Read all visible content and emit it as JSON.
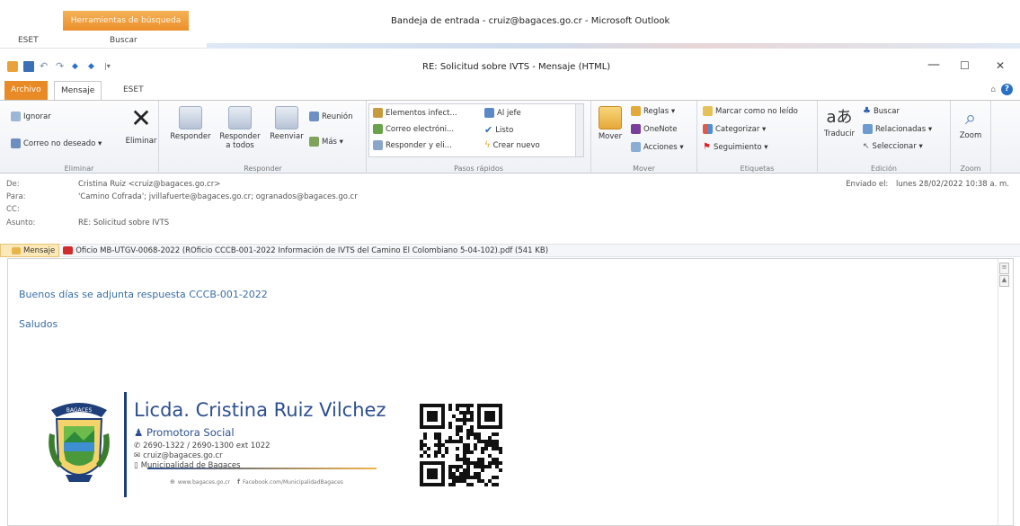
{
  "outer": {
    "context_tab": "Herramientas de búsqueda",
    "tabs": [
      "ESET",
      "Buscar"
    ],
    "title": "Bandeja de entrada - cruiz@bagaces.go.cr - Microsoft Outlook"
  },
  "window": {
    "title": "RE: Solicitud sobre IVTS - Mensaje (HTML)",
    "controls": {
      "minimize": "—",
      "maximize": "☐",
      "close": "✕"
    }
  },
  "ribbon_tabs": {
    "file": "Archivo",
    "message": "Mensaje",
    "eset": "ESET"
  },
  "ribbon": {
    "eliminar": {
      "ignore": "Ignorar",
      "junk": "Correo no deseado ▾",
      "delete": "Eliminar",
      "label": "Eliminar"
    },
    "responder": {
      "reply": "Responder",
      "reply_all_1": "Responder",
      "reply_all_2": "a todos",
      "forward": "Reenviar",
      "meeting": "Reunión",
      "more": "Más ▾",
      "label": "Responder"
    },
    "pasos": {
      "items": [
        "Elementos infect...",
        "Al jefe",
        "Correo electróni...",
        "Listo",
        "Responder y eli...",
        "Crear nuevo"
      ],
      "label": "Pasos rápidos"
    },
    "mover": {
      "move": "Mover",
      "rules": "Reglas ▾",
      "onenote": "OneNote",
      "actions": "Acciones ▾",
      "label": "Mover"
    },
    "etiquetas": {
      "unread": "Marcar como no leído",
      "categorize": "Categorizar ▾",
      "followup": "Seguimiento ▾",
      "label": "Etiquetas"
    },
    "edicion": {
      "translate": "Traducir",
      "find": "Buscar",
      "related": "Relacionadas ▾",
      "select": "Seleccionar ▾",
      "label": "Edición"
    },
    "zoom": {
      "zoom": "Zoom",
      "label": "Zoom"
    }
  },
  "header": {
    "from_label": "De:",
    "from": "Cristina Ruiz <cruiz@bagaces.go.cr>",
    "to_label": "Para:",
    "to": "'Camino Cofrada'; jvillafuerte@bagaces.go.cr; ogranados@bagaces.go.cr",
    "cc_label": "CC:",
    "cc": "",
    "subject_label": "Asunto:",
    "subject": "RE: Solicitud sobre IVTS",
    "sent_label": "Enviado el:",
    "sent": "lunes 28/02/2022 10:38 a. m."
  },
  "attachments": {
    "message_tab": "Mensaje",
    "file": "Oficio MB-UTGV-0068-2022 (ROficio CCCB-001-2022 Información de IVTS del Camino El Colombiano 5-04-102).pdf (541 KB)"
  },
  "body": {
    "line1": "Buenos días se adjunta respuesta CCCB-001-2022",
    "line2": "Saludos"
  },
  "signature": {
    "name": "Licda. Cristina Ruiz Vilchez",
    "role": "Promotora Social",
    "phone": "2690-1322 / 2690-1300 ext 1022",
    "email": "cruiz@bagaces.go.cr",
    "org": "Municipalidad de Bagaces",
    "web": "www.bagaces.go.cr",
    "facebook": "Facebook.com/MunicipalidadBagaces",
    "emblem_text": "BAGACES"
  }
}
